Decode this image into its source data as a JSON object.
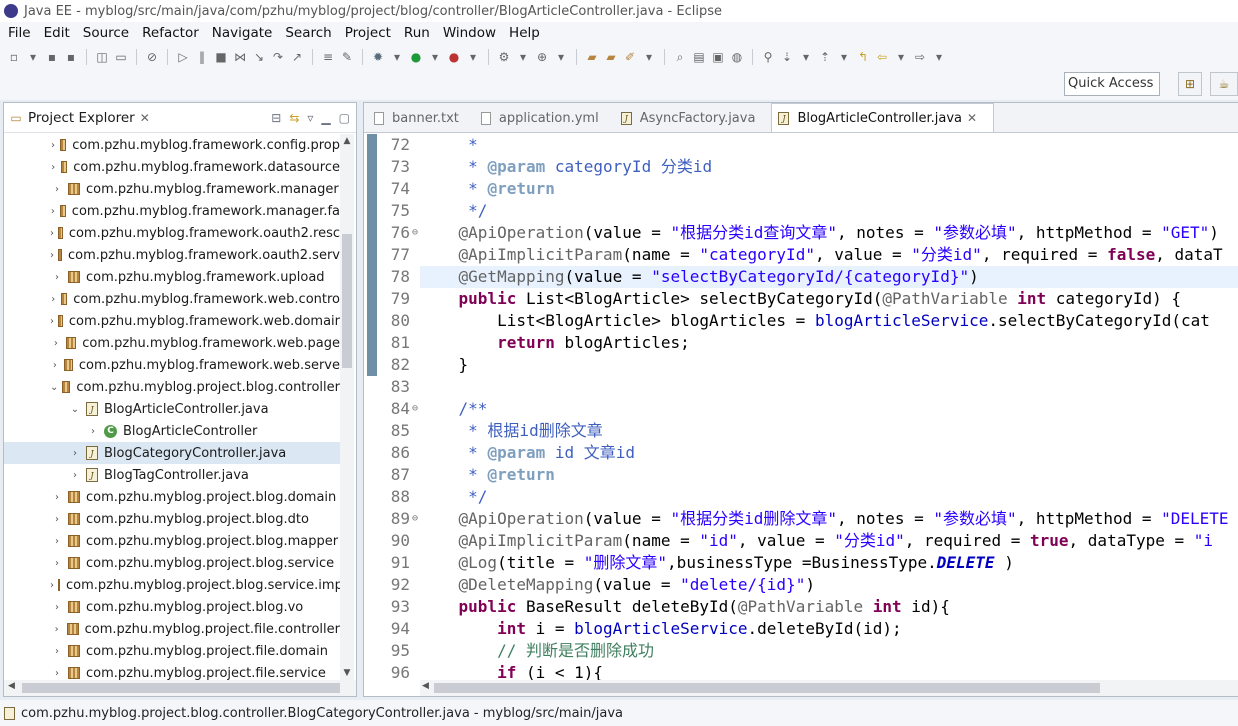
{
  "window": {
    "title": "Java EE - myblog/src/main/java/com/pzhu/myblog/project/blog/controller/BlogArticleController.java - Eclipse"
  },
  "menu": [
    "File",
    "Edit",
    "Source",
    "Refactor",
    "Navigate",
    "Search",
    "Project",
    "Run",
    "Window",
    "Help"
  ],
  "quick_access": "Quick Access",
  "explorer": {
    "title": "Project Explorer",
    "items": [
      {
        "label": "com.pzhu.myblog.framework.config.prop",
        "twisty": "›",
        "icon": "package",
        "indent": 0
      },
      {
        "label": "com.pzhu.myblog.framework.datasource",
        "twisty": "›",
        "icon": "package",
        "indent": 0
      },
      {
        "label": "com.pzhu.myblog.framework.manager",
        "twisty": "›",
        "icon": "package",
        "indent": 0
      },
      {
        "label": "com.pzhu.myblog.framework.manager.fa",
        "twisty": "›",
        "icon": "package",
        "indent": 0
      },
      {
        "label": "com.pzhu.myblog.framework.oauth2.resc",
        "twisty": "›",
        "icon": "package",
        "indent": 0
      },
      {
        "label": "com.pzhu.myblog.framework.oauth2.serv",
        "twisty": "›",
        "icon": "package",
        "indent": 0
      },
      {
        "label": "com.pzhu.myblog.framework.upload",
        "twisty": "›",
        "icon": "package",
        "indent": 0
      },
      {
        "label": "com.pzhu.myblog.framework.web.contro",
        "twisty": "›",
        "icon": "package",
        "indent": 0
      },
      {
        "label": "com.pzhu.myblog.framework.web.domair",
        "twisty": "›",
        "icon": "package",
        "indent": 0
      },
      {
        "label": "com.pzhu.myblog.framework.web.page",
        "twisty": "›",
        "icon": "package",
        "indent": 0
      },
      {
        "label": "com.pzhu.myblog.framework.web.serve",
        "twisty": "›",
        "icon": "package",
        "indent": 0
      },
      {
        "label": "com.pzhu.myblog.project.blog.controller",
        "twisty": "⌄",
        "icon": "package",
        "indent": 0
      },
      {
        "label": "BlogArticleController.java",
        "twisty": "⌄",
        "icon": "java",
        "indent": 1
      },
      {
        "label": "BlogArticleController",
        "twisty": "›",
        "icon": "class",
        "indent": 2
      },
      {
        "label": "BlogCategoryController.java",
        "twisty": "›",
        "icon": "java",
        "indent": 1,
        "selected": true
      },
      {
        "label": "BlogTagController.java",
        "twisty": "›",
        "icon": "java",
        "indent": 1
      },
      {
        "label": "com.pzhu.myblog.project.blog.domain",
        "twisty": "›",
        "icon": "package",
        "indent": 0
      },
      {
        "label": "com.pzhu.myblog.project.blog.dto",
        "twisty": "›",
        "icon": "package",
        "indent": 0
      },
      {
        "label": "com.pzhu.myblog.project.blog.mapper",
        "twisty": "›",
        "icon": "package",
        "indent": 0
      },
      {
        "label": "com.pzhu.myblog.project.blog.service",
        "twisty": "›",
        "icon": "package",
        "indent": 0
      },
      {
        "label": "com.pzhu.myblog.project.blog.service.imp",
        "twisty": "›",
        "icon": "package",
        "indent": 0
      },
      {
        "label": "com.pzhu.myblog.project.blog.vo",
        "twisty": "›",
        "icon": "package",
        "indent": 0
      },
      {
        "label": "com.pzhu.myblog.project.file.controller",
        "twisty": "›",
        "icon": "package",
        "indent": 0
      },
      {
        "label": "com.pzhu.myblog.project.file.domain",
        "twisty": "›",
        "icon": "package",
        "indent": 0
      },
      {
        "label": "com.pzhu.myblog.project.file.service",
        "twisty": "›",
        "icon": "package",
        "indent": 0
      }
    ]
  },
  "editor": {
    "tabs": [
      {
        "label": "banner.txt",
        "active": false
      },
      {
        "label": "application.yml",
        "active": false
      },
      {
        "label": "AsyncFactory.java",
        "active": false
      },
      {
        "label": "BlogArticleController.java",
        "active": true
      }
    ],
    "current_line": 78,
    "lines": [
      {
        "n": 72,
        "fold": "",
        "tokens": [
          [
            "cmt",
            "     *"
          ]
        ]
      },
      {
        "n": 73,
        "fold": "",
        "tokens": [
          [
            "cmt",
            "     * "
          ],
          [
            "cmttag",
            "@param"
          ],
          [
            "cmt",
            " categoryId 分类id"
          ]
        ]
      },
      {
        "n": 74,
        "fold": "",
        "tokens": [
          [
            "cmt",
            "     * "
          ],
          [
            "cmttag",
            "@return"
          ]
        ]
      },
      {
        "n": 75,
        "fold": "",
        "tokens": [
          [
            "cmt",
            "     */"
          ]
        ]
      },
      {
        "n": 76,
        "fold": "⊖",
        "tokens": [
          [
            "ann",
            "    @ApiOperation"
          ],
          [
            "",
            "(value = "
          ],
          [
            "str",
            "\"根据分类id查询文章\""
          ],
          [
            "",
            ", notes = "
          ],
          [
            "str",
            "\"参数必填\""
          ],
          [
            "",
            ", httpMethod = "
          ],
          [
            "str",
            "\"GET\""
          ],
          [
            "",
            ")"
          ]
        ]
      },
      {
        "n": 77,
        "fold": "",
        "tokens": [
          [
            "ann",
            "    @ApiImplicitParam"
          ],
          [
            "",
            "(name = "
          ],
          [
            "str",
            "\"categoryId\""
          ],
          [
            "",
            ", value = "
          ],
          [
            "str",
            "\"分类id\""
          ],
          [
            "",
            ", required = "
          ],
          [
            "kw",
            "false"
          ],
          [
            "",
            ", dataT"
          ]
        ]
      },
      {
        "n": 78,
        "fold": "",
        "tokens": [
          [
            "ann",
            "    @GetMapping"
          ],
          [
            "",
            "(value = "
          ],
          [
            "str",
            "\"selectByCategoryId/{categoryId}\""
          ],
          [
            "",
            ")"
          ]
        ]
      },
      {
        "n": 79,
        "fold": "",
        "tokens": [
          [
            "kw",
            "    public"
          ],
          [
            "",
            " List<BlogArticle> selectByCategoryId("
          ],
          [
            "ann",
            "@PathVariable"
          ],
          [
            "",
            " "
          ],
          [
            "kw",
            "int"
          ],
          [
            "",
            " categoryId) {"
          ]
        ]
      },
      {
        "n": 80,
        "fold": "",
        "tokens": [
          [
            "",
            "        List<BlogArticle> blogArticles = "
          ],
          [
            "field",
            "blogArticleService"
          ],
          [
            "",
            ".selectByCategoryId(cat"
          ]
        ]
      },
      {
        "n": 81,
        "fold": "",
        "tokens": [
          [
            "kw",
            "        return"
          ],
          [
            "",
            " blogArticles;"
          ]
        ]
      },
      {
        "n": 82,
        "fold": "",
        "tokens": [
          [
            "",
            "    }"
          ]
        ]
      },
      {
        "n": 83,
        "fold": "",
        "tokens": [
          [
            "",
            ""
          ]
        ]
      },
      {
        "n": 84,
        "fold": "⊖",
        "tokens": [
          [
            "cmt",
            "    /**"
          ]
        ]
      },
      {
        "n": 85,
        "fold": "",
        "tokens": [
          [
            "cmt",
            "     * 根据id删除文章"
          ]
        ]
      },
      {
        "n": 86,
        "fold": "",
        "tokens": [
          [
            "cmt",
            "     * "
          ],
          [
            "cmttag",
            "@param"
          ],
          [
            "cmt",
            " id 文章id"
          ]
        ]
      },
      {
        "n": 87,
        "fold": "",
        "tokens": [
          [
            "cmt",
            "     * "
          ],
          [
            "cmttag",
            "@return"
          ]
        ]
      },
      {
        "n": 88,
        "fold": "",
        "tokens": [
          [
            "cmt",
            "     */"
          ]
        ]
      },
      {
        "n": 89,
        "fold": "⊖",
        "tokens": [
          [
            "ann",
            "    @ApiOperation"
          ],
          [
            "",
            "(value = "
          ],
          [
            "str",
            "\"根据分类id删除文章\""
          ],
          [
            "",
            ", notes = "
          ],
          [
            "str",
            "\"参数必填\""
          ],
          [
            "",
            ", httpMethod = "
          ],
          [
            "str",
            "\"DELETE"
          ]
        ]
      },
      {
        "n": 90,
        "fold": "",
        "tokens": [
          [
            "ann",
            "    @ApiImplicitParam"
          ],
          [
            "",
            "(name = "
          ],
          [
            "str",
            "\"id\""
          ],
          [
            "",
            ", value = "
          ],
          [
            "str",
            "\"分类id\""
          ],
          [
            "",
            ", required = "
          ],
          [
            "kw",
            "true"
          ],
          [
            "",
            ", dataType = "
          ],
          [
            "str",
            "\"i"
          ]
        ]
      },
      {
        "n": 91,
        "fold": "",
        "tokens": [
          [
            "ann",
            "    @Log"
          ],
          [
            "",
            "(title = "
          ],
          [
            "str",
            "\"删除文章\""
          ],
          [
            "",
            ",businessType =BusinessType."
          ],
          [
            "static",
            "DELETE"
          ],
          [
            "",
            " )"
          ]
        ]
      },
      {
        "n": 92,
        "fold": "",
        "tokens": [
          [
            "ann",
            "    @DeleteMapping"
          ],
          [
            "",
            "(value = "
          ],
          [
            "str",
            "\"delete/{id}\""
          ],
          [
            "",
            ")"
          ]
        ]
      },
      {
        "n": 93,
        "fold": "",
        "tokens": [
          [
            "kw",
            "    public"
          ],
          [
            "",
            " BaseResult deleteById("
          ],
          [
            "ann",
            "@PathVariable"
          ],
          [
            "",
            " "
          ],
          [
            "kw",
            "int"
          ],
          [
            "",
            " id){"
          ]
        ]
      },
      {
        "n": 94,
        "fold": "",
        "tokens": [
          [
            "kw",
            "        int"
          ],
          [
            "",
            " i = "
          ],
          [
            "field",
            "blogArticleService"
          ],
          [
            "",
            ".deleteById(id);"
          ]
        ]
      },
      {
        "n": 95,
        "fold": "",
        "tokens": [
          [
            "cmtline",
            "        // 判断是否删除成功"
          ]
        ]
      },
      {
        "n": 96,
        "fold": "",
        "tokens": [
          [
            "kw",
            "        if"
          ],
          [
            "",
            " (i < 1){"
          ]
        ]
      }
    ]
  },
  "status": {
    "text": "com.pzhu.myblog.project.blog.controller.BlogCategoryController.java - myblog/src/main/java"
  }
}
